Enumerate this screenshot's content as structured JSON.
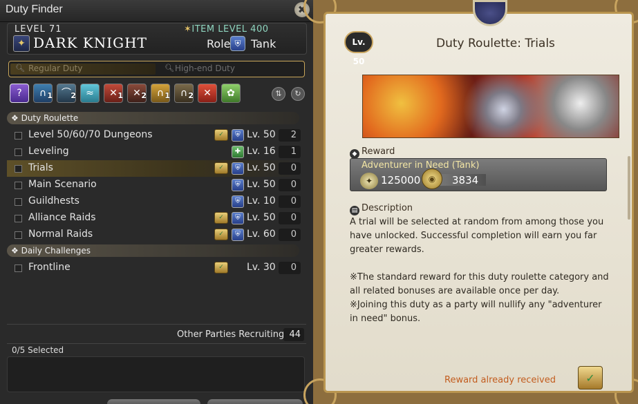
{
  "window": {
    "title": "Duty Finder"
  },
  "character": {
    "level_label": "LEVEL 71",
    "item_level_label": "ITEM LEVEL 400",
    "job_name": "DARK KNIGHT",
    "role_label": "Role:",
    "role_name": "Tank"
  },
  "tabs": [
    {
      "label": "Regular Duty",
      "selected": true
    },
    {
      "label": "High-end Duty",
      "selected": false
    }
  ],
  "filters": [
    {
      "name": "roulette-filter-icon",
      "badge": ""
    },
    {
      "name": "dungeon-filter-icon",
      "badge": "1"
    },
    {
      "name": "guildhest-filter-icon",
      "badge": "2"
    },
    {
      "name": "trial-filter-icon",
      "badge": ""
    },
    {
      "name": "raid-filter-icon",
      "badge": "1"
    },
    {
      "name": "raid2-filter-icon",
      "badge": "2"
    },
    {
      "name": "quest-filter-icon",
      "badge": "1"
    },
    {
      "name": "pvp-filter-icon",
      "badge": "2"
    },
    {
      "name": "pvp2-filter-icon",
      "badge": ""
    },
    {
      "name": "gold-saucer-filter-icon",
      "badge": ""
    }
  ],
  "categories": {
    "duty_roulette": "Duty Roulette",
    "daily_challenges": "Daily Challenges"
  },
  "duties": [
    {
      "name": "Level 50/60/70 Dungeons",
      "level": "Lv. 50",
      "count": "2",
      "chest": true,
      "role": "tank",
      "selected": false
    },
    {
      "name": "Leveling",
      "level": "Lv. 16",
      "count": "1",
      "chest": false,
      "role": "all",
      "selected": false
    },
    {
      "name": "Trials",
      "level": "Lv. 50",
      "count": "0",
      "chest": true,
      "role": "tank",
      "selected": true
    },
    {
      "name": "Main Scenario",
      "level": "Lv. 50",
      "count": "0",
      "chest": false,
      "role": "tank",
      "selected": false
    },
    {
      "name": "Guildhests",
      "level": "Lv. 10",
      "count": "0",
      "chest": false,
      "role": "tank",
      "selected": false
    },
    {
      "name": "Alliance Raids",
      "level": "Lv. 50",
      "count": "0",
      "chest": true,
      "role": "tank",
      "selected": false
    },
    {
      "name": "Normal Raids",
      "level": "Lv. 60",
      "count": "0",
      "chest": true,
      "role": "tank",
      "selected": false
    }
  ],
  "daily": [
    {
      "name": "Frontline",
      "level": "Lv. 30",
      "count": "0",
      "chest": true
    }
  ],
  "footer": {
    "other_parties_label": "Other Parties Recruiting",
    "other_parties_count": "44",
    "selected_label": "0/5 Selected"
  },
  "detail": {
    "level_badge": "Lv. 50",
    "title": "Duty Roulette: Trials",
    "reward_label": "Reward",
    "adventurer_label": "Adventurer in Need (Tank)",
    "seals_value": "125000",
    "gil_value": "3834",
    "description_label": "Description",
    "description": "A trial will be selected at random from among those you have unlocked. Successful completion will earn you far greater rewards.\n\n※The standard reward for this duty roulette category and all related bonuses are available once per day.\n※Joining this duty as a party will nullify any \"adventurer in need\" bonus.",
    "received_label": "Reward already received"
  },
  "colors": {
    "accent_gold": "#c9a65a",
    "item_level": "#8fd6c0",
    "received": "#c25c1e"
  }
}
